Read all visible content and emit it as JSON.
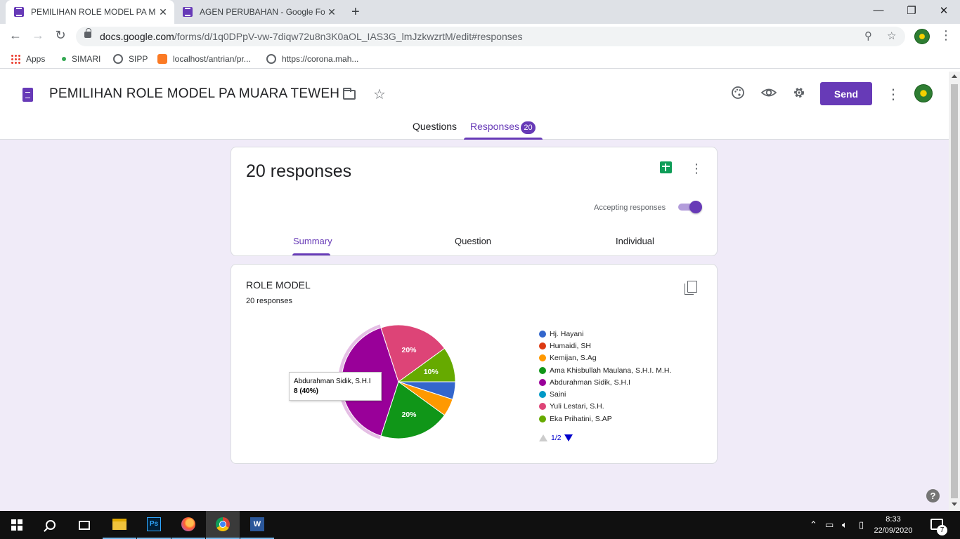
{
  "browser": {
    "tabs": [
      {
        "title": "PEMILIHAN ROLE MODEL PA MU"
      },
      {
        "title": "AGEN PERUBAHAN - Google For"
      }
    ],
    "url_domain": "docs.google.com",
    "url_path": "/forms/d/1q0DPpV-vw-7diqw72u8n3K0aOL_IAS3G_lmJzkwzrtM/edit#responses",
    "bookmarks": [
      {
        "label": "Apps",
        "icon": "apps-grid-icon"
      },
      {
        "label": "SIMARI",
        "icon": "leaf-icon"
      },
      {
        "label": "SIPP",
        "icon": "globe-icon"
      },
      {
        "label": "localhost/antrian/pr...",
        "icon": "xampp-icon"
      },
      {
        "label": "https://corona.mah...",
        "icon": "globe-icon"
      }
    ]
  },
  "form": {
    "title": "PEMILIHAN ROLE MODEL PA MUARA TEWEH",
    "send_label": "Send",
    "tabs": {
      "questions": "Questions",
      "responses": "Responses",
      "responses_count": "20"
    }
  },
  "summary": {
    "responses_title": "20 responses",
    "accepting_label": "Accepting responses",
    "accepting": true,
    "subtabs": [
      "Summary",
      "Question",
      "Individual"
    ]
  },
  "question": {
    "title": "ROLE MODEL",
    "count_label": "20 responses",
    "tooltip": {
      "label": "Abdurahman Sidik, S.H.I",
      "value": "8 (40%)"
    },
    "legend_page": "1/2"
  },
  "colors": {
    "accent": "#673ab7",
    "page_bg": "#f0ebf8"
  },
  "chart_data": {
    "type": "pie",
    "categories": [
      "Hj. Hayani",
      "Humaidi, SH",
      "Kemijan, S.Ag",
      "Ama Khisbullah Maulana, S.H.I. M.H.",
      "Abdurahman Sidik, S.H.I",
      "Saini",
      "Yuli Lestari, S.H.",
      "Eka Prihatini, S.AP"
    ],
    "values": [
      1,
      0,
      1,
      4,
      8,
      0,
      4,
      2
    ],
    "colors": [
      "#3366cc",
      "#dc3912",
      "#ff9900",
      "#109618",
      "#990099",
      "#0099c6",
      "#dd4477",
      "#66aa00"
    ],
    "slice_labels": [
      "",
      "",
      "",
      "20%",
      "",
      "",
      "20%",
      "10%"
    ],
    "highlighted": "Abdurahman Sidik, S.H.I",
    "legend_position": "right"
  },
  "taskbar": {
    "time": "8:33",
    "date": "22/09/2020",
    "notifications": "7",
    "apps": [
      "windows-start",
      "search",
      "task-view",
      "file-explorer",
      "photoshop",
      "firefox",
      "chrome",
      "word"
    ]
  }
}
